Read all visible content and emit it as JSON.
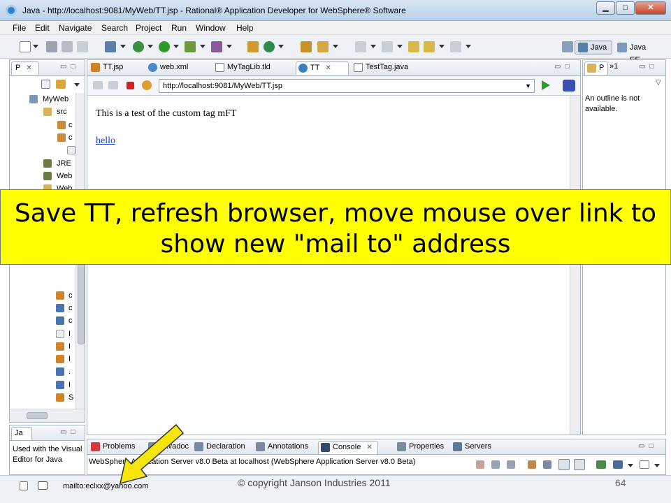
{
  "window": {
    "title": "Java - http://localhost:9081/MyWeb/TT.jsp - Rational® Application Developer for WebSphere® Software",
    "minimize": "▁",
    "maximize": "□",
    "close": "✕"
  },
  "menu": [
    "File",
    "Edit",
    "Navigate",
    "Search",
    "Project",
    "Run",
    "Window",
    "Help"
  ],
  "perspectives": [
    {
      "label": "Java",
      "active": true
    },
    {
      "label": "Java EE",
      "active": false
    }
  ],
  "left_panel": {
    "tab_label": "P",
    "tree": [
      {
        "label": "MyWeb",
        "icon": "project-icon"
      },
      {
        "label": "src",
        "icon": "folder-icon"
      },
      {
        "label": "c",
        "icon": "package-icon"
      },
      {
        "label": "c",
        "icon": "package-icon"
      },
      {
        "label": "",
        "icon": "file-icon"
      },
      {
        "label": "JRE",
        "icon": "library-icon"
      },
      {
        "label": "Web",
        "icon": "library-icon"
      },
      {
        "label": "Web",
        "icon": "folder-icon"
      }
    ],
    "tree_bottom": [
      {
        "label": "c",
        "icon": "jsp-icon"
      },
      {
        "label": "c",
        "icon": "xml-icon"
      },
      {
        "label": "c",
        "icon": "xml-icon"
      },
      {
        "label": "I",
        "icon": "file-icon"
      },
      {
        "label": "I",
        "icon": "jsp-icon"
      },
      {
        "label": "I",
        "icon": "jsp-icon"
      },
      {
        "label": ".",
        "icon": "xml-icon"
      },
      {
        "label": "I",
        "icon": "xml-icon"
      },
      {
        "label": "S",
        "icon": "jsp-icon"
      }
    ]
  },
  "editor": {
    "tabs": [
      {
        "label": "TT.jsp",
        "icon": "jsp-icon",
        "active": false
      },
      {
        "label": "web.xml",
        "icon": "web-icon",
        "active": false
      },
      {
        "label": "MyTagLib.tld",
        "icon": "xml-icon",
        "active": false
      },
      {
        "label": "TT",
        "icon": "browser-icon",
        "active": true
      },
      {
        "label": "TestTag.java",
        "icon": "java-icon",
        "active": false
      }
    ],
    "url": "http://localhost:9081/MyWeb/TT.jsp",
    "page_text": "This is a test of the custom tag mFT",
    "link_text": "hello"
  },
  "outline": {
    "tab_label": "P",
    "tab_extra": "»1",
    "message": "An outline is not available."
  },
  "bottom_left": {
    "tab_label": "Ja",
    "text": "Used with the Visual Editor for Java"
  },
  "bottom_tabs": [
    {
      "label": "Problems",
      "icon": "problems-icon",
      "active": false
    },
    {
      "label": "Javadoc",
      "icon": "javadoc-icon",
      "active": false
    },
    {
      "label": "Declaration",
      "icon": "declaration-icon",
      "active": false
    },
    {
      "label": "Annotations",
      "icon": "annotations-icon",
      "active": false
    },
    {
      "label": "Console",
      "icon": "console-icon",
      "active": true
    },
    {
      "label": "Properties",
      "icon": "properties-icon",
      "active": false
    },
    {
      "label": "Servers",
      "icon": "servers-icon",
      "active": false
    }
  ],
  "console_text": "WebSphere Application Server v8.0 Beta at localhost (WebSphere Application Server v8.0 Beta)",
  "status": {
    "mailto": "mailto:eclxx@yahoo.com",
    "copyright": "© copyright Janson Industries 2011",
    "page_number": "64"
  },
  "banner": {
    "text": "Save TT, refresh browser, move mouse over link to show new \"mail to\" address",
    "color": "#ffff00"
  },
  "arrow_color": "#f5e50a"
}
